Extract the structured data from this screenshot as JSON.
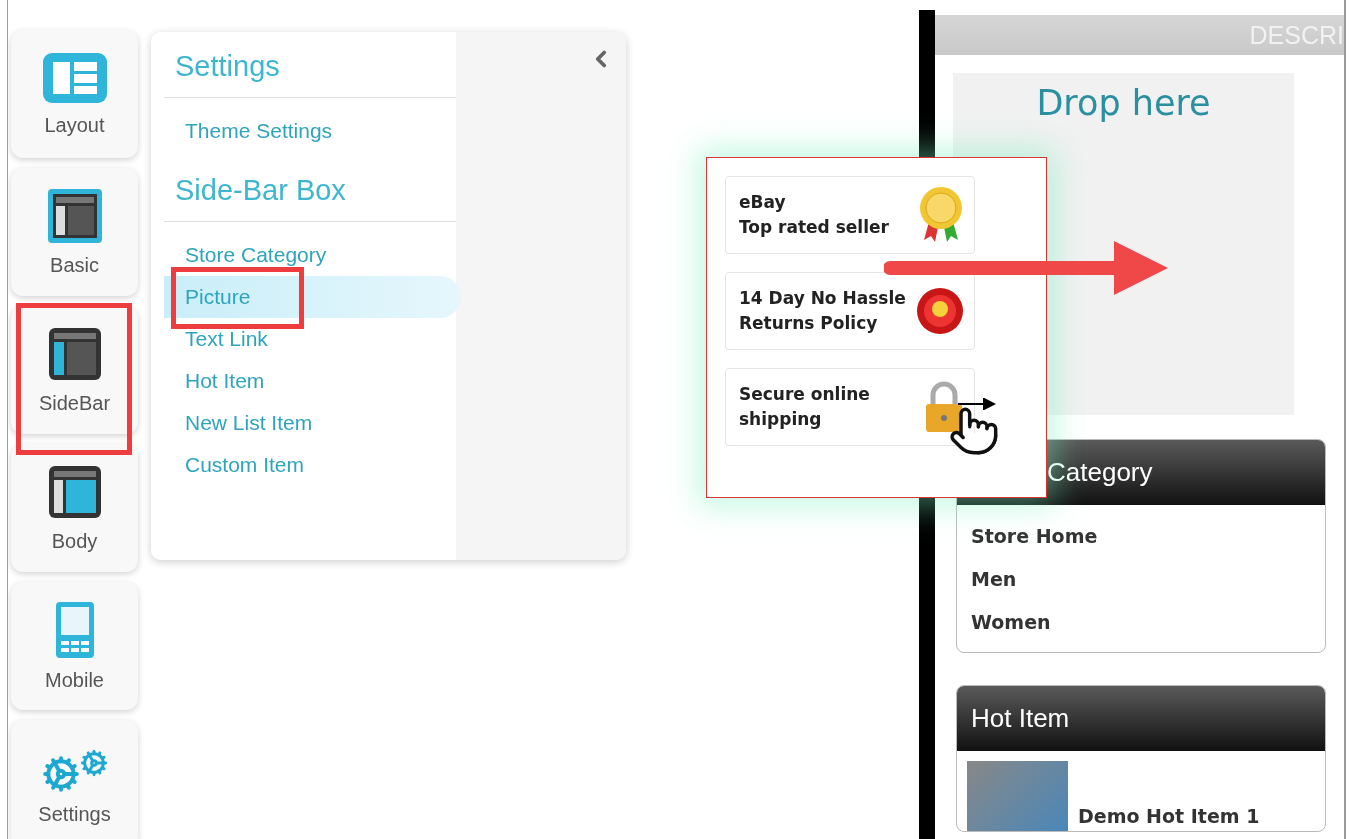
{
  "nav": [
    {
      "label": "Layout",
      "kind": "layout",
      "highlighted": false
    },
    {
      "label": "Basic",
      "kind": "basic",
      "highlighted": false
    },
    {
      "label": "SideBar",
      "kind": "sidebar",
      "highlighted": true
    },
    {
      "label": "Body",
      "kind": "body",
      "highlighted": false
    },
    {
      "label": "Mobile",
      "kind": "mobile",
      "highlighted": false
    },
    {
      "label": "Settings",
      "kind": "settings",
      "highlighted": false
    }
  ],
  "menu": {
    "sections": [
      {
        "title": "Settings",
        "items": [
          {
            "label": "Theme Settings",
            "selected": false,
            "highlighted": false
          }
        ]
      },
      {
        "title": "Side-Bar Box",
        "items": [
          {
            "label": "Store Category",
            "selected": false,
            "highlighted": false
          },
          {
            "label": "Picture",
            "selected": true,
            "highlighted": true
          },
          {
            "label": "Text Link",
            "selected": false,
            "highlighted": false
          },
          {
            "label": "Hot Item",
            "selected": false,
            "highlighted": false
          },
          {
            "label": "New List Item",
            "selected": false,
            "highlighted": false
          },
          {
            "label": "Custom Item",
            "selected": false,
            "highlighted": false
          }
        ]
      }
    ]
  },
  "badges": [
    {
      "kind": "seal",
      "text": "eBay\nTop rated seller"
    },
    {
      "kind": "medal",
      "text": "14 Day No Hassle\nReturns Policy"
    },
    {
      "kind": "lock",
      "text": "Secure online\nshipping"
    }
  ],
  "preview": {
    "header": "DESCRI",
    "drop_zone": "Drop here",
    "category": {
      "title": "Category",
      "items": [
        "Store Home",
        "Men",
        "Women"
      ]
    },
    "hot_item": {
      "title": "Hot Item",
      "items": [
        "Demo Hot Item 1"
      ]
    }
  }
}
